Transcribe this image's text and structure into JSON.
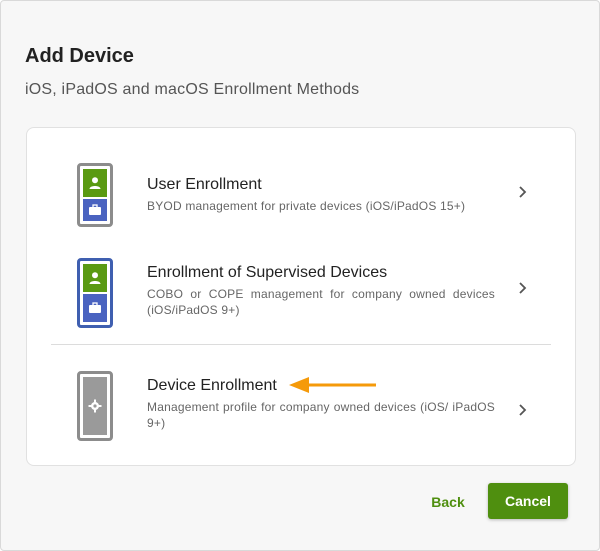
{
  "dialog": {
    "title": "Add Device",
    "subtitle": "iOS, iPadOS and macOS Enrollment Methods"
  },
  "options": [
    {
      "title": "User Enrollment",
      "description": "BYOD management for private devices (iOS/iPadOS 15+)",
      "icon": "phone-user-briefcase-icon"
    },
    {
      "title": "Enrollment of Supervised Devices",
      "description": "COBO or COPE management for company owned devices (iOS/iPadOS 9+)",
      "icon": "phone-supervised-icon"
    },
    {
      "title": "Device Enrollment",
      "description": "Management profile for company owned devices (iOS/ iPadOS 9+)",
      "icon": "phone-gear-icon"
    }
  ],
  "buttons": {
    "back": "Back",
    "cancel": "Cancel"
  },
  "colors": {
    "accent_green": "#4f8f0f",
    "indigo": "#4a63c0",
    "arrow_orange": "#f59a0a"
  }
}
